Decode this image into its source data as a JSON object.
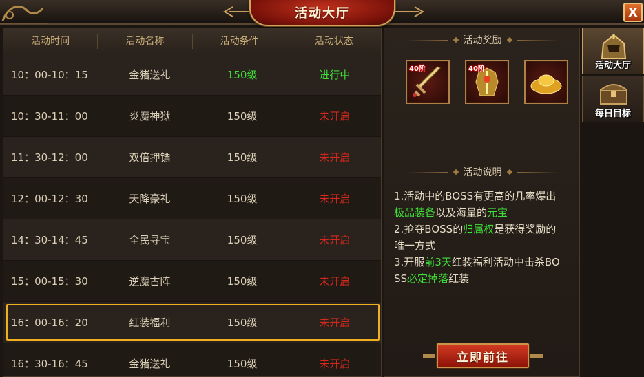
{
  "window": {
    "title": "活动大厅",
    "close_glyph": "X"
  },
  "table": {
    "headers": [
      "活动时间",
      "活动名称",
      "活动条件",
      "活动状态"
    ],
    "rows": [
      {
        "time": "10：00-10：15",
        "name": "金猪送礼",
        "condition": "150级",
        "status": "进行中",
        "status_color": "#3fe03a"
      },
      {
        "time": "10：30-11：00",
        "name": "炎魔神狱",
        "condition": "150级",
        "status": "未开启",
        "status_color": "#d8281c"
      },
      {
        "time": "11：30-12：00",
        "name": "双倍押镖",
        "condition": "150级",
        "status": "未开启",
        "status_color": "#d8281c"
      },
      {
        "time": "12：00-12：30",
        "name": "天降豪礼",
        "condition": "150级",
        "status": "未开启",
        "status_color": "#d8281c"
      },
      {
        "time": "14：30-14：45",
        "name": "全民寻宝",
        "condition": "150级",
        "status": "未开启",
        "status_color": "#d8281c"
      },
      {
        "time": "15：00-15：30",
        "name": "逆魔古阵",
        "condition": "150级",
        "status": "未开启",
        "status_color": "#d8281c"
      },
      {
        "time": "16：00-16：20",
        "name": "红装福利",
        "condition": "150级",
        "status": "未开启",
        "status_color": "#d8281c",
        "selected": true
      },
      {
        "time": "16：30-16：45",
        "name": "金猪送礼",
        "condition": "150级",
        "status": "未开启",
        "status_color": "#d8281c"
      }
    ]
  },
  "rewards": {
    "title": "活动奖励",
    "items": [
      {
        "icon": "sword-icon",
        "tier": "40阶"
      },
      {
        "icon": "armor-icon",
        "tier": "40阶"
      },
      {
        "icon": "gold-ingot-icon",
        "tier": ""
      }
    ]
  },
  "description": {
    "title": "活动说明",
    "lines": [
      [
        {
          "t": "1.活动中的BOSS有更高的几率爆出",
          "g": false
        }
      ],
      [
        {
          "t": "极品装备",
          "g": true
        },
        {
          "t": "以及海量的",
          "g": false
        },
        {
          "t": "元宝",
          "g": true
        }
      ],
      [
        {
          "t": "2.抢夺BOSS的",
          "g": false
        },
        {
          "t": "归属权",
          "g": true
        },
        {
          "t": "是获得奖励的",
          "g": false
        }
      ],
      [
        {
          "t": "唯一方式",
          "g": false
        }
      ],
      [
        {
          "t": "3.开服",
          "g": false
        },
        {
          "t": "前3天",
          "g": true
        },
        {
          "t": "红装福利活动中击杀BO",
          "g": false
        }
      ],
      [
        {
          "t": "SS",
          "g": false
        },
        {
          "t": "必定掉落",
          "g": true
        },
        {
          "t": "红装",
          "g": false
        }
      ]
    ]
  },
  "go_button": "立即前往",
  "side_tabs": [
    {
      "label": "活动大厅",
      "icon": "armor-helmet-icon",
      "active": true
    },
    {
      "label": "每日目标",
      "icon": "treasure-chest-icon",
      "active": false
    }
  ],
  "colors": {
    "accent_gold": "#c9a060",
    "status_active": "#3fe03a",
    "status_closed": "#d8281c",
    "highlight": "#3fe03a",
    "selection_border": "#f0b020"
  }
}
